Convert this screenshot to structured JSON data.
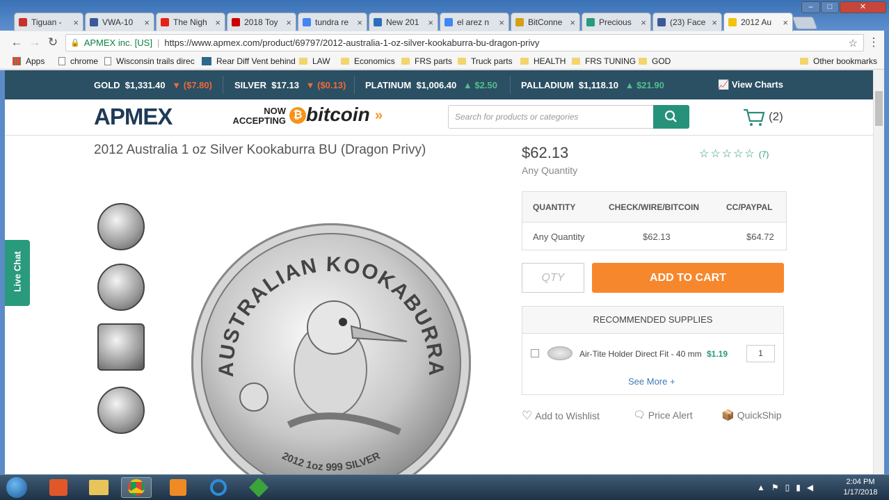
{
  "browser": {
    "tabs": [
      {
        "label": "Tiguan - ",
        "color": "#c9302c"
      },
      {
        "label": "VWA-10",
        "color": "#3b5998"
      },
      {
        "label": "The Nigh",
        "color": "#e62117"
      },
      {
        "label": "2018 Toy",
        "color": "#cc0000"
      },
      {
        "label": "tundra re",
        "color": "#4285f4"
      },
      {
        "label": "New 201",
        "color": "#2a6ebb"
      },
      {
        "label": "el arez n",
        "color": "#4285f4"
      },
      {
        "label": "BitConne",
        "color": "#d4a017"
      },
      {
        "label": "Precious",
        "color": "#2a9a7d"
      },
      {
        "label": "(23) Face",
        "color": "#3b5998"
      },
      {
        "label": "2012 Au",
        "color": "#f4c20d"
      }
    ],
    "close_glyph": "×",
    "security_label": "APMEX inc. [US]",
    "url": "https://www.apmex.com/product/69797/2012-australia-1-oz-silver-kookaburra-bu-dragon-privy",
    "bookmarks": [
      "Apps",
      "chrome",
      "Wisconsin trails direc",
      "Rear Diff Vent behind",
      "LAW",
      "Economics",
      "FRS parts",
      "Truck parts",
      "HEALTH",
      "FRS TUNING",
      "GOD"
    ],
    "other_bookmarks": "Other bookmarks"
  },
  "ticker": {
    "gold": {
      "name": "GOLD",
      "price": "$1,331.40",
      "change": "($7.80)"
    },
    "silver": {
      "name": "SILVER",
      "price": "$17.13",
      "change": "($0.13)"
    },
    "platinum": {
      "name": "PLATINUM",
      "price": "$1,006.40",
      "change": "$2.50"
    },
    "palladium": {
      "name": "PALLADIUM",
      "price": "$1,118.10",
      "change": "$21.90"
    },
    "view_charts": "View Charts"
  },
  "header": {
    "logo": "APMEX",
    "now": "NOW",
    "accepting": "ACCEPTING",
    "bitcoin": "bitcoin",
    "arrows": "»",
    "search_placeholder": "Search for products or categories",
    "cart_count": "(2)"
  },
  "product": {
    "title": "2012 Australia 1 oz Silver Kookaburra BU (Dragon Privy)",
    "price": "$62.13",
    "price_sub": "Any Quantity",
    "stars": "☆☆☆☆☆",
    "review_count": "(7)",
    "coin_text_top": "AUSTRALIAN KOOKABURRA",
    "coin_text_bottom": "2012 1oz 999 SILVER"
  },
  "pricing_table": {
    "headers": [
      "QUANTITY",
      "CHECK/WIRE/BITCOIN",
      "CC/PAYPAL"
    ],
    "row": [
      "Any Quantity",
      "$62.13",
      "$64.72"
    ]
  },
  "cart": {
    "qty_placeholder": "QTY",
    "add_label": "ADD TO CART"
  },
  "supplies": {
    "title": "RECOMMENDED SUPPLIES",
    "item_name": "Air-Tite Holder Direct Fit - 40 mm",
    "item_price": "$1.19",
    "item_qty": "1",
    "see_more": "See More +"
  },
  "actions": {
    "wishlist": "Add to Wishlist",
    "price_alert": "Price Alert",
    "quickship": "QuickShip"
  },
  "live_chat": "Live Chat",
  "taskbar": {
    "time": "2:04 PM",
    "date": "1/17/2018"
  }
}
